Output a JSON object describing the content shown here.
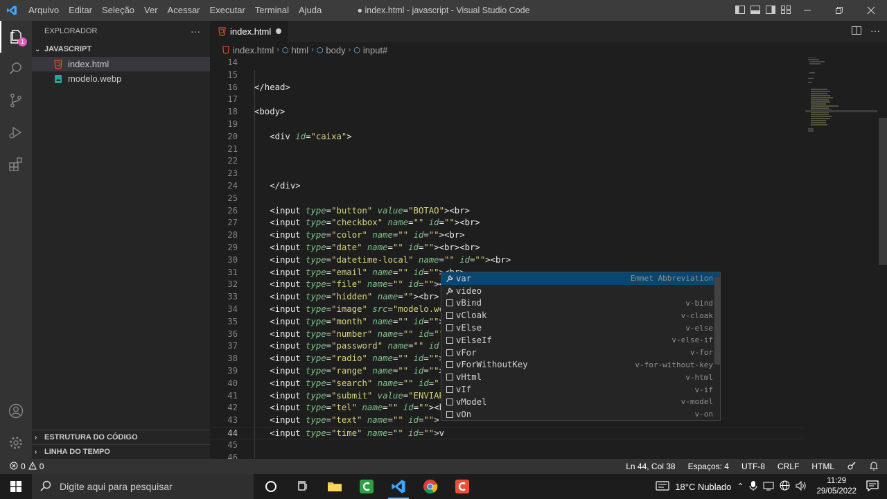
{
  "titlebar": {
    "menu": [
      "Arquivo",
      "Editar",
      "Seleção",
      "Ver",
      "Acessar",
      "Executar",
      "Terminal",
      "Ajuda"
    ],
    "title": "● index.html - javascript - Visual Studio Code"
  },
  "activitybar": {
    "explorer_badge": "1"
  },
  "sidebar": {
    "header": "EXPLORADOR",
    "more": "···",
    "folder": "JAVASCRIPT",
    "files": [
      {
        "name": "index.html",
        "icon": "html5-icon"
      },
      {
        "name": "modelo.webp",
        "icon": "image-file-icon"
      }
    ],
    "outline": "ESTRUTURA DO CÓDIGO",
    "timeline": "LINHA DO TEMPO"
  },
  "tab": {
    "label": "index.html"
  },
  "breadcrumb": [
    "index.html",
    "html",
    "body",
    "input#"
  ],
  "editor": {
    "lines": [
      {
        "n": 14,
        "code": []
      },
      {
        "n": 15,
        "code": []
      },
      {
        "n": 16,
        "code": [
          [
            "t",
            "</head>"
          ]
        ]
      },
      {
        "n": 17,
        "code": []
      },
      {
        "n": 18,
        "code": [
          [
            "t",
            "<body>"
          ]
        ]
      },
      {
        "n": 19,
        "code": []
      },
      {
        "n": 20,
        "code": [
          [
            "t",
            "   <div "
          ],
          [
            "a",
            "id"
          ],
          [
            "p",
            "="
          ],
          [
            "s",
            "\"caixa\""
          ],
          [
            "t",
            ">"
          ]
        ]
      },
      {
        "n": 21,
        "code": []
      },
      {
        "n": 22,
        "code": []
      },
      {
        "n": 23,
        "code": []
      },
      {
        "n": 24,
        "code": [
          [
            "t",
            "   </div>"
          ]
        ]
      },
      {
        "n": 25,
        "code": []
      },
      {
        "n": 26,
        "code": [
          [
            "t",
            "   <input "
          ],
          [
            "a",
            "type"
          ],
          [
            "p",
            "="
          ],
          [
            "s",
            "\"button\""
          ],
          [
            "t",
            " "
          ],
          [
            "a",
            "value"
          ],
          [
            "p",
            "="
          ],
          [
            "s",
            "\"BOTAO\""
          ],
          [
            "t",
            "><br>"
          ]
        ]
      },
      {
        "n": 27,
        "code": [
          [
            "t",
            "   <input "
          ],
          [
            "a",
            "type"
          ],
          [
            "p",
            "="
          ],
          [
            "s",
            "\"checkbox\""
          ],
          [
            "t",
            " "
          ],
          [
            "a",
            "name"
          ],
          [
            "p",
            "="
          ],
          [
            "s",
            "\"\""
          ],
          [
            "t",
            " "
          ],
          [
            "a",
            "id"
          ],
          [
            "p",
            "="
          ],
          [
            "s",
            "\"\""
          ],
          [
            "t",
            "><br>"
          ]
        ]
      },
      {
        "n": 28,
        "code": [
          [
            "t",
            "   <input "
          ],
          [
            "a",
            "type"
          ],
          [
            "p",
            "="
          ],
          [
            "s",
            "\"color\""
          ],
          [
            "t",
            " "
          ],
          [
            "a",
            "name"
          ],
          [
            "p",
            "="
          ],
          [
            "s",
            "\"\""
          ],
          [
            "t",
            " "
          ],
          [
            "a",
            "id"
          ],
          [
            "p",
            "="
          ],
          [
            "s",
            "\"\""
          ],
          [
            "t",
            "><br>"
          ]
        ]
      },
      {
        "n": 29,
        "code": [
          [
            "t",
            "   <input "
          ],
          [
            "a",
            "type"
          ],
          [
            "p",
            "="
          ],
          [
            "s",
            "\"date\""
          ],
          [
            "t",
            " "
          ],
          [
            "a",
            "name"
          ],
          [
            "p",
            "="
          ],
          [
            "s",
            "\"\""
          ],
          [
            "t",
            " "
          ],
          [
            "a",
            "id"
          ],
          [
            "p",
            "="
          ],
          [
            "s",
            "\"\""
          ],
          [
            "t",
            "><br><br>"
          ]
        ]
      },
      {
        "n": 30,
        "code": [
          [
            "t",
            "   <input "
          ],
          [
            "a",
            "type"
          ],
          [
            "p",
            "="
          ],
          [
            "s",
            "\"datetime-local\""
          ],
          [
            "t",
            " "
          ],
          [
            "a",
            "name"
          ],
          [
            "p",
            "="
          ],
          [
            "s",
            "\"\""
          ],
          [
            "t",
            " "
          ],
          [
            "a",
            "id"
          ],
          [
            "p",
            "="
          ],
          [
            "s",
            "\"\""
          ],
          [
            "t",
            "><br>"
          ]
        ]
      },
      {
        "n": 31,
        "code": [
          [
            "t",
            "   <input "
          ],
          [
            "a",
            "type"
          ],
          [
            "p",
            "="
          ],
          [
            "s",
            "\"email\""
          ],
          [
            "t",
            " "
          ],
          [
            "a",
            "name"
          ],
          [
            "p",
            "="
          ],
          [
            "s",
            "\"\""
          ],
          [
            "t",
            " "
          ],
          [
            "a",
            "id"
          ],
          [
            "p",
            "="
          ],
          [
            "s",
            "\"\""
          ],
          [
            "t",
            "><br>"
          ]
        ]
      },
      {
        "n": 32,
        "code": [
          [
            "t",
            "   <input "
          ],
          [
            "a",
            "type"
          ],
          [
            "p",
            "="
          ],
          [
            "s",
            "\"file\""
          ],
          [
            "t",
            " "
          ],
          [
            "a",
            "name"
          ],
          [
            "p",
            "="
          ],
          [
            "s",
            "\"\""
          ],
          [
            "t",
            " "
          ],
          [
            "a",
            "id"
          ],
          [
            "p",
            "="
          ],
          [
            "s",
            "\"\""
          ],
          [
            "t",
            "><"
          ]
        ]
      },
      {
        "n": 33,
        "code": [
          [
            "t",
            "   <input "
          ],
          [
            "a",
            "type"
          ],
          [
            "p",
            "="
          ],
          [
            "s",
            "\"hidden\""
          ],
          [
            "t",
            " "
          ],
          [
            "a",
            "name"
          ],
          [
            "p",
            "="
          ],
          [
            "s",
            "\"\""
          ],
          [
            "t",
            "><br>"
          ]
        ]
      },
      {
        "n": 34,
        "code": [
          [
            "t",
            "   <input "
          ],
          [
            "a",
            "type"
          ],
          [
            "p",
            "="
          ],
          [
            "s",
            "\"image\""
          ],
          [
            "t",
            " "
          ],
          [
            "a",
            "src"
          ],
          [
            "p",
            "="
          ],
          [
            "s",
            "\"modelo.we"
          ]
        ]
      },
      {
        "n": 35,
        "code": [
          [
            "t",
            "   <input "
          ],
          [
            "a",
            "type"
          ],
          [
            "p",
            "="
          ],
          [
            "s",
            "\"month\""
          ],
          [
            "t",
            " "
          ],
          [
            "a",
            "name"
          ],
          [
            "p",
            "="
          ],
          [
            "s",
            "\"\""
          ],
          [
            "t",
            " "
          ],
          [
            "a",
            "id"
          ],
          [
            "p",
            "="
          ],
          [
            "s",
            "\"\""
          ],
          [
            "t",
            ">"
          ]
        ]
      },
      {
        "n": 36,
        "code": [
          [
            "t",
            "   <input "
          ],
          [
            "a",
            "type"
          ],
          [
            "p",
            "="
          ],
          [
            "s",
            "\"number\""
          ],
          [
            "t",
            " "
          ],
          [
            "a",
            "name"
          ],
          [
            "p",
            "="
          ],
          [
            "s",
            "\"\""
          ],
          [
            "t",
            " "
          ],
          [
            "a",
            "id"
          ],
          [
            "p",
            "="
          ],
          [
            "s",
            "\"\""
          ]
        ]
      },
      {
        "n": 37,
        "code": [
          [
            "t",
            "   <input "
          ],
          [
            "a",
            "type"
          ],
          [
            "p",
            "="
          ],
          [
            "s",
            "\"password\""
          ],
          [
            "t",
            " "
          ],
          [
            "a",
            "name"
          ],
          [
            "p",
            "="
          ],
          [
            "s",
            "\"\""
          ],
          [
            "t",
            " "
          ],
          [
            "a",
            "id"
          ]
        ]
      },
      {
        "n": 38,
        "code": [
          [
            "t",
            "   <input "
          ],
          [
            "a",
            "type"
          ],
          [
            "p",
            "="
          ],
          [
            "s",
            "\"radio\""
          ],
          [
            "t",
            " "
          ],
          [
            "a",
            "name"
          ],
          [
            "p",
            "="
          ],
          [
            "s",
            "\"\""
          ],
          [
            "t",
            " "
          ],
          [
            "a",
            "id"
          ],
          [
            "p",
            "="
          ],
          [
            "s",
            "\"\""
          ],
          [
            "t",
            ">"
          ]
        ]
      },
      {
        "n": 39,
        "code": [
          [
            "t",
            "   <input "
          ],
          [
            "a",
            "type"
          ],
          [
            "p",
            "="
          ],
          [
            "s",
            "\"range\""
          ],
          [
            "t",
            " "
          ],
          [
            "a",
            "name"
          ],
          [
            "p",
            "="
          ],
          [
            "s",
            "\"\""
          ],
          [
            "t",
            " "
          ],
          [
            "a",
            "id"
          ],
          [
            "p",
            "="
          ],
          [
            "s",
            "\"\""
          ],
          [
            "t",
            ">"
          ]
        ]
      },
      {
        "n": 40,
        "code": [
          [
            "t",
            "   <input "
          ],
          [
            "a",
            "type"
          ],
          [
            "p",
            "="
          ],
          [
            "s",
            "\"search\""
          ],
          [
            "t",
            " "
          ],
          [
            "a",
            "name"
          ],
          [
            "p",
            "="
          ],
          [
            "s",
            "\"\""
          ],
          [
            "t",
            " "
          ],
          [
            "a",
            "id"
          ],
          [
            "p",
            "="
          ],
          [
            "s",
            "\""
          ]
        ]
      },
      {
        "n": 41,
        "code": [
          [
            "t",
            "   <input "
          ],
          [
            "a",
            "type"
          ],
          [
            "p",
            "="
          ],
          [
            "s",
            "\"submit\""
          ],
          [
            "t",
            " "
          ],
          [
            "a",
            "value"
          ],
          [
            "p",
            "="
          ],
          [
            "s",
            "\"ENVIAR"
          ]
        ]
      },
      {
        "n": 42,
        "code": [
          [
            "t",
            "   <input "
          ],
          [
            "a",
            "type"
          ],
          [
            "p",
            "="
          ],
          [
            "s",
            "\"tel\""
          ],
          [
            "t",
            " "
          ],
          [
            "a",
            "name"
          ],
          [
            "p",
            "="
          ],
          [
            "s",
            "\"\""
          ],
          [
            "t",
            " "
          ],
          [
            "a",
            "id"
          ],
          [
            "p",
            "="
          ],
          [
            "s",
            "\"\""
          ],
          [
            "t",
            "><b"
          ]
        ]
      },
      {
        "n": 43,
        "code": [
          [
            "t",
            "   <input "
          ],
          [
            "a",
            "type"
          ],
          [
            "p",
            "="
          ],
          [
            "s",
            "\"text\""
          ],
          [
            "t",
            " "
          ],
          [
            "a",
            "name"
          ],
          [
            "p",
            "="
          ],
          [
            "s",
            "\"\""
          ],
          [
            "t",
            " "
          ],
          [
            "a",
            "id"
          ],
          [
            "p",
            "="
          ],
          [
            "s",
            "\"\""
          ],
          [
            "t",
            ">"
          ]
        ]
      },
      {
        "n": 44,
        "code": [
          [
            "t",
            "   <input "
          ],
          [
            "a",
            "type"
          ],
          [
            "p",
            "="
          ],
          [
            "s",
            "\"time\""
          ],
          [
            "t",
            " "
          ],
          [
            "a",
            "name"
          ],
          [
            "p",
            "="
          ],
          [
            "s",
            "\"\""
          ],
          [
            "t",
            " "
          ],
          [
            "a",
            "id"
          ],
          [
            "p",
            "="
          ],
          [
            "s",
            "\"\""
          ],
          [
            "t",
            ">v"
          ]
        ]
      },
      {
        "n": 45,
        "code": []
      },
      {
        "n": 46,
        "code": []
      }
    ]
  },
  "suggest": {
    "items": [
      {
        "label": "var",
        "detail": "Emmet Abbreviation",
        "icon": "wrench-icon"
      },
      {
        "label": "video",
        "detail": "",
        "icon": "wrench-icon"
      },
      {
        "label": "vBind",
        "detail": "v-bind",
        "icon": "snippet-icon"
      },
      {
        "label": "vCloak",
        "detail": "v-cloak",
        "icon": "snippet-icon"
      },
      {
        "label": "vElse",
        "detail": "v-else",
        "icon": "snippet-icon"
      },
      {
        "label": "vElseIf",
        "detail": "v-else-if",
        "icon": "snippet-icon"
      },
      {
        "label": "vFor",
        "detail": "v-for",
        "icon": "snippet-icon"
      },
      {
        "label": "vForWithoutKey",
        "detail": "v-for-without-key",
        "icon": "snippet-icon"
      },
      {
        "label": "vHtml",
        "detail": "v-html",
        "icon": "snippet-icon"
      },
      {
        "label": "vIf",
        "detail": "v-if",
        "icon": "snippet-icon"
      },
      {
        "label": "vModel",
        "detail": "v-model",
        "icon": "snippet-icon"
      },
      {
        "label": "vOn",
        "detail": "v-on",
        "icon": "snippet-icon"
      }
    ]
  },
  "statusbar": {
    "errors": "0",
    "warnings": "0",
    "position": "Ln 44, Col 38",
    "spaces": "Espaços: 4",
    "encoding": "UTF-8",
    "eol": "CRLF",
    "language": "HTML"
  },
  "taskbar": {
    "search_placeholder": "Digite aqui para pesquisar",
    "weather": "18°C  Nublado",
    "time": "11:29",
    "date": "29/05/2022"
  },
  "colors": {
    "tag": "#e8e8e8",
    "attribute": "#7ec48a",
    "string": "#d8d47a",
    "selection": "#094771",
    "html_icon": "#e44d26"
  }
}
